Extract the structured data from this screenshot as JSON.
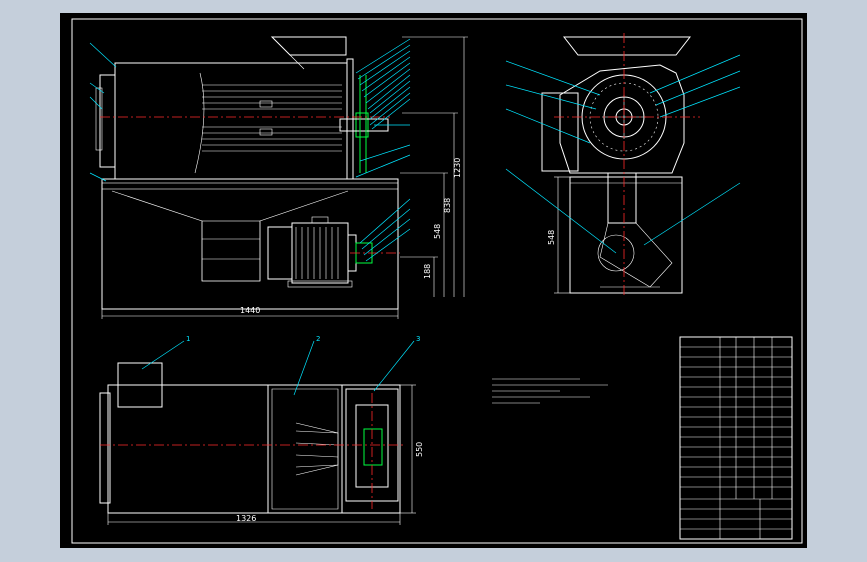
{
  "colors": {
    "background": "#c5cfdb",
    "sheet": "#000000",
    "outline": "#ffffff",
    "centerline": "#ff2a2a",
    "leader": "#00e5ff",
    "pulley": "#00ff40"
  },
  "dimensions": {
    "front_height": "1230",
    "front_mid": "838",
    "front_lower": "548",
    "front_base": "188",
    "front_length": "1440",
    "side_height": "548",
    "top_length": "1326",
    "top_width": "550"
  },
  "part_numbers": {
    "top_view": [
      "1",
      "2",
      "3"
    ]
  },
  "drawing_icons": [
    "front-view",
    "side-view",
    "top-view",
    "title-block"
  ]
}
